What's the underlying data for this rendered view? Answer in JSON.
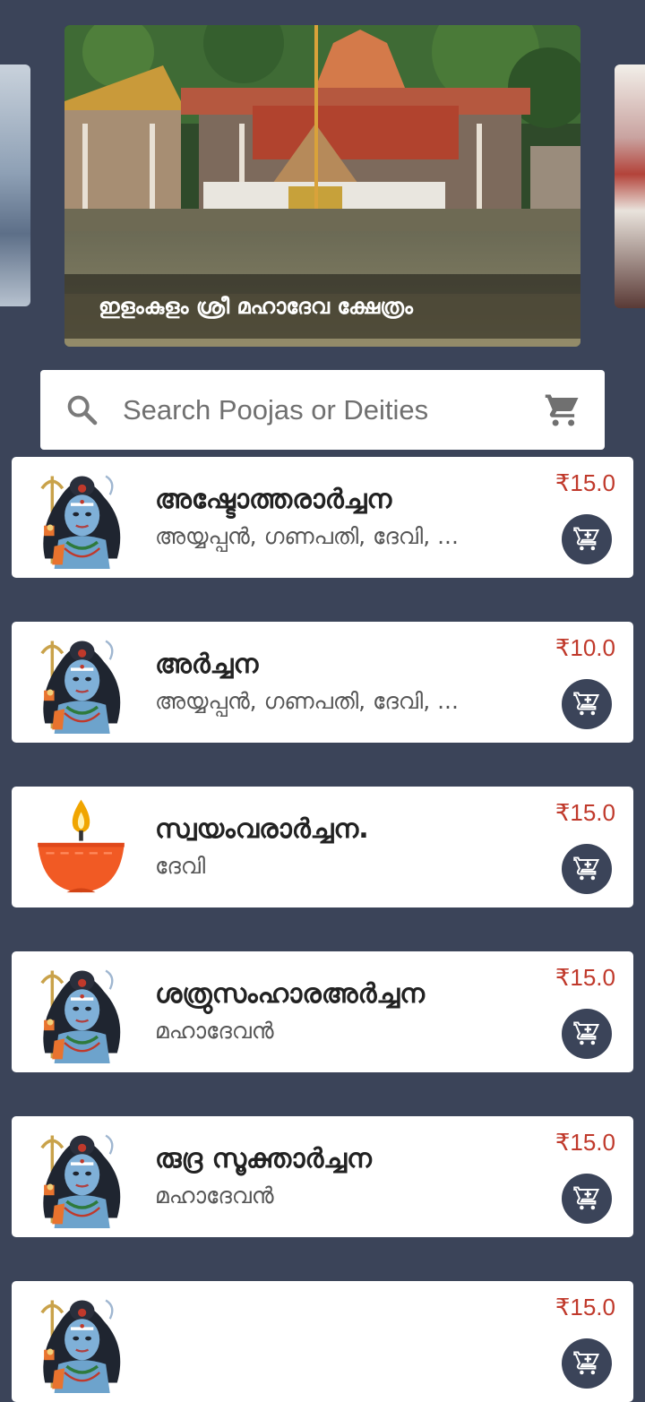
{
  "banner": {
    "caption": "ഇളംകുളം ശ്രീ മഹാദേവ ക്ഷേത്രം"
  },
  "search": {
    "placeholder": "Search Poojas or Deities"
  },
  "items": [
    {
      "title": "അഷ്ടോത്തരാർച്ചന",
      "deities": "അയ്യപ്പൻ, ഗണപതി, ദേവി, ...",
      "price": "₹15.0",
      "image": "shiva-icon"
    },
    {
      "title": "അർച്ചന",
      "deities": "അയ്യപ്പൻ, ഗണപതി, ദേവി, ...",
      "price": "₹10.0",
      "image": "shiva-icon"
    },
    {
      "title": "സ്വയംവരാർച്ചന.",
      "deities": "ദേവി",
      "price": "₹15.0",
      "image": "oil-lamp-icon"
    },
    {
      "title": "ശത്രുസംഹാരഅർച്ചന",
      "deities": "മഹാദേവൻ",
      "price": "₹15.0",
      "image": "shiva-icon"
    },
    {
      "title": "രുദ്ര സൂക്താർച്ചന",
      "deities": "മഹാദേവൻ",
      "price": "₹15.0",
      "image": "shiva-icon"
    },
    {
      "title": "",
      "deities": "",
      "price": "₹15.0",
      "image": "shiva-icon"
    }
  ],
  "colors": {
    "background": "#3b4459",
    "price": "#c0392b",
    "button": "#3b4459"
  }
}
